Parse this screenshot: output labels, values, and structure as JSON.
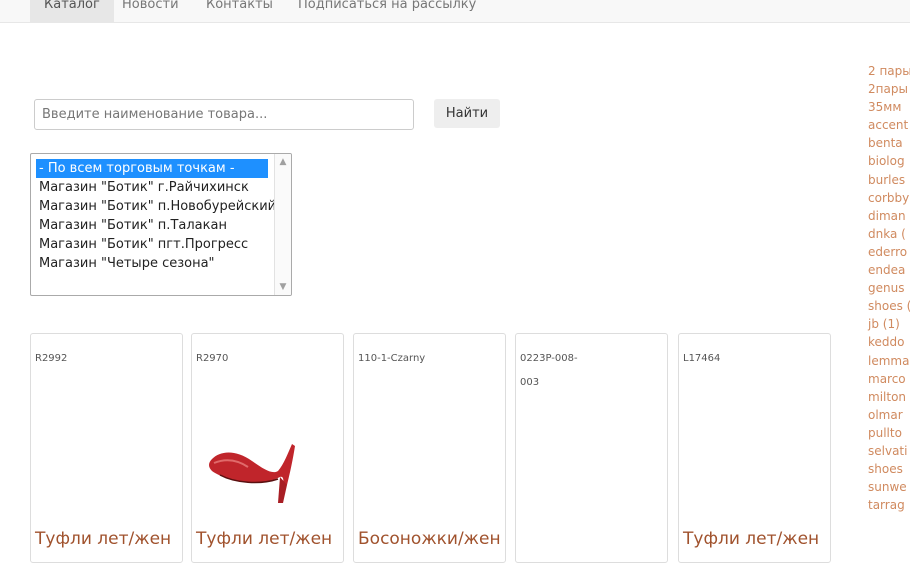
{
  "nav": {
    "items": [
      {
        "label": "Каталог",
        "active": true
      },
      {
        "label": "Новости",
        "active": false
      },
      {
        "label": "Контакты",
        "active": false
      },
      {
        "label": "Подписаться на рассылку",
        "active": false
      }
    ]
  },
  "search": {
    "placeholder": "Введите наименование товара...",
    "value": "",
    "button_label": "Найти"
  },
  "stores": {
    "options": [
      {
        "label": "- По всем торговым точкам -",
        "selected": true
      },
      {
        "label": "Магазин \"Ботик\" г.Райчихинск",
        "selected": false
      },
      {
        "label": "Магазин \"Ботик\" п.Новобурейский",
        "selected": false
      },
      {
        "label": "Магазин \"Ботик\" п.Талакан",
        "selected": false
      },
      {
        "label": "Магазин \"Ботик\" пгт.Прогресс",
        "selected": false
      },
      {
        "label": "Магазин \"Четыре сезона\"",
        "selected": false
      }
    ]
  },
  "products": [
    {
      "code": "R2992",
      "title": "Туфли лет/жен",
      "has_image": false
    },
    {
      "code": "R2970",
      "title": "Туфли лет/жен",
      "has_image": true
    },
    {
      "code": "110-1-Czarny",
      "title": "Босоножки/жен",
      "has_image": false
    },
    {
      "code": "0223P-008-003",
      "title": "",
      "has_image": false
    },
    {
      "code": "L17464",
      "title": "Туфли лет/жен",
      "has_image": false
    }
  ],
  "brands": [
    "2 пары",
    " 2пары",
    " 35мм",
    " accent",
    " benta",
    " biolog",
    " burles",
    " corbby",
    " diman",
    " dnka (",
    " ederro",
    " endea",
    " genus",
    "shoes (",
    " jb (1)",
    " keddo",
    " lemma",
    " marco",
    " milton",
    " olmar",
    " pullto",
    " selvati",
    " shoes",
    " sunwe",
    " tarrag"
  ],
  "colors": {
    "accent": "#1e90ff",
    "title": "#a0522d",
    "brand_link": "#d08a5f",
    "shoe": "#c0252b"
  }
}
